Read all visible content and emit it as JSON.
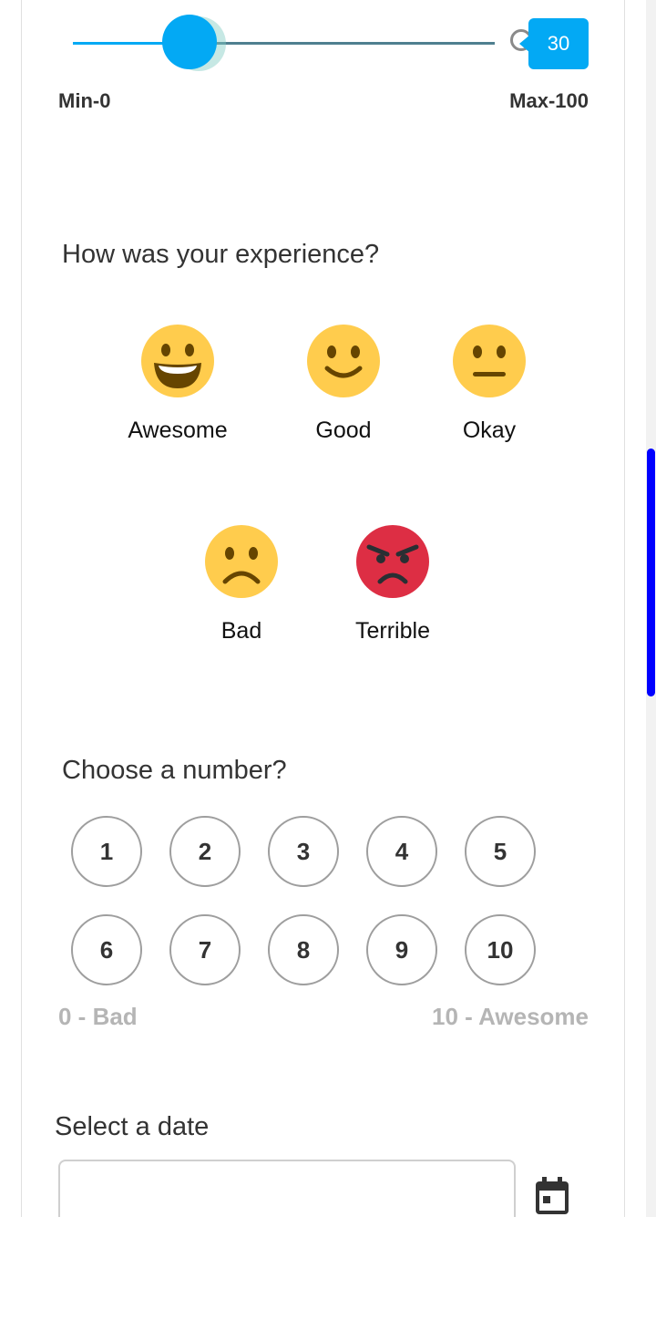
{
  "slider": {
    "value": "30",
    "value_fraction": 0.3,
    "min_label": "Min-0",
    "max_label": "Max-100"
  },
  "experience": {
    "title": "How was your experience?",
    "options": [
      {
        "label": "Awesome",
        "icon": "grinning-face-icon"
      },
      {
        "label": "Good",
        "icon": "smiling-face-icon"
      },
      {
        "label": "Okay",
        "icon": "neutral-face-icon"
      },
      {
        "label": "Bad",
        "icon": "frowning-face-icon"
      },
      {
        "label": "Terrible",
        "icon": "angry-face-icon"
      }
    ]
  },
  "number_picker": {
    "title": "Choose a number?",
    "numbers": [
      "1",
      "2",
      "3",
      "4",
      "5",
      "6",
      "7",
      "8",
      "9",
      "10"
    ],
    "low_label": "0 - Bad",
    "high_label": "10 - Awesome"
  },
  "date": {
    "title": "Select a date",
    "value": "",
    "icon": "calendar-icon"
  },
  "colors": {
    "accent": "#03a9f4",
    "emoji_yellow": "#ffcc4d",
    "emoji_red": "#dd2e44",
    "scrollbar": "#0000ff"
  }
}
